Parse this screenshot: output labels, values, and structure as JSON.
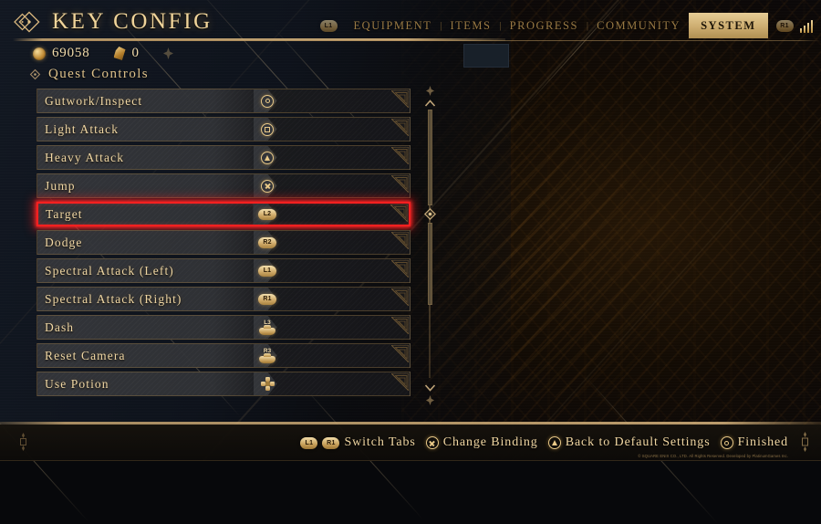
{
  "header": {
    "title": "KEY CONFIG",
    "title_ornament_icon": "double-diamond-ornament",
    "stats": {
      "currency_icon": "coin-icon",
      "currency_value": "69058",
      "shard_icon": "shard-icon",
      "shard_value": "0",
      "extra_icon": "small-mark-icon"
    },
    "breadcrumb": {
      "icon": "diamond-icon",
      "text": "Quest  Controls"
    }
  },
  "tabs": {
    "prev_button": "L1",
    "next_button": "R1",
    "items": [
      {
        "label": "EQUIPMENT",
        "active": false
      },
      {
        "label": "ITEMS",
        "active": false
      },
      {
        "label": "PROGRESS",
        "active": false
      },
      {
        "label": "COMMUNITY",
        "active": false
      },
      {
        "label": "SYSTEM",
        "active": true
      }
    ],
    "separator": "|",
    "signal_icon": "signal-bars-icon"
  },
  "bindings": [
    {
      "action": "Gutwork/Inspect",
      "key": "circle",
      "key_label": "",
      "selected": false
    },
    {
      "action": "Light Attack",
      "key": "square",
      "key_label": "",
      "selected": false
    },
    {
      "action": "Heavy Attack",
      "key": "triangle",
      "key_label": "",
      "selected": false
    },
    {
      "action": "Jump",
      "key": "cross",
      "key_label": "",
      "selected": false
    },
    {
      "action": "Target",
      "key": "shoulder",
      "key_label": "L2",
      "selected": true
    },
    {
      "action": "Dodge",
      "key": "shoulder",
      "key_label": "R2",
      "selected": false
    },
    {
      "action": "Spectral Attack (Left)",
      "key": "shoulder",
      "key_label": "L1",
      "selected": false
    },
    {
      "action": "Spectral Attack (Right)",
      "key": "shoulder",
      "key_label": "R1",
      "selected": false
    },
    {
      "action": "Dash",
      "key": "stick",
      "key_label": "L3",
      "selected": false
    },
    {
      "action": "Reset Camera",
      "key": "stick",
      "key_label": "R3",
      "selected": false
    },
    {
      "action": "Use Potion",
      "key": "dpad",
      "key_label": "",
      "selected": false
    }
  ],
  "scrollbar": {
    "up_icon": "chevron-up-icon",
    "down_icon": "chevron-down-icon",
    "thumb_icon": "diamond-thumb-icon",
    "cap_icon": "star-ornament-icon"
  },
  "footer": {
    "hints": [
      {
        "glyph": "L1",
        "glyph2": "R1",
        "label": "Switch Tabs"
      },
      {
        "glyph": "cross",
        "glyph2": "",
        "label": "Change Binding"
      },
      {
        "glyph": "triangle",
        "glyph2": "",
        "label": "Back to Default Settings"
      },
      {
        "glyph": "circle",
        "glyph2": "",
        "label": "Finished"
      }
    ],
    "copyright": "© SQUARE ENIX CO., LTD. All Rights Reserved. Developed by PlatinumGames Inc."
  },
  "colors": {
    "gold": "#e8c98a",
    "gold_bright": "#f0d49a",
    "selection_red": "#ff2020",
    "tab_active_bg": "#cdad70",
    "panel_dark": "#16161a"
  }
}
